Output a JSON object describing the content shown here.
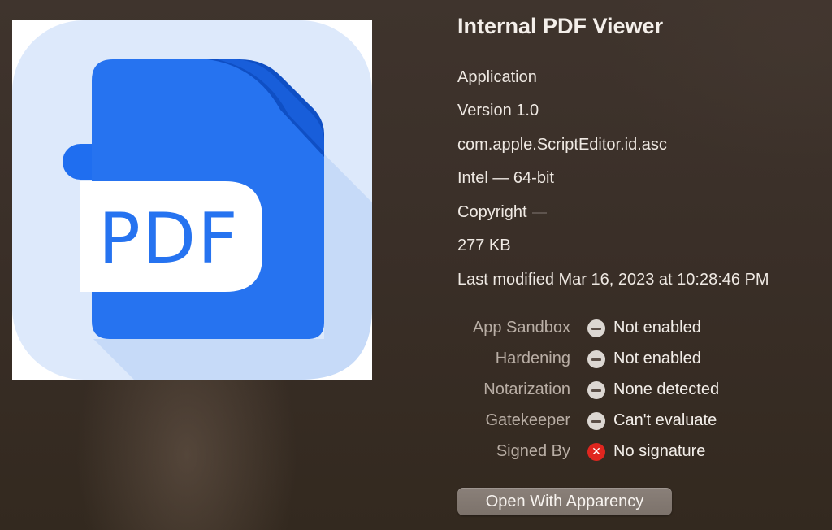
{
  "app": {
    "name": "Internal PDF Viewer",
    "icon": "pdf-document-icon",
    "icon_text": "PDF"
  },
  "info": {
    "kind": "Application",
    "version": "Version 1.0",
    "bundle_id": "com.apple.ScriptEditor.id.asc",
    "architecture": "Intel — 64-bit",
    "copyright_label": "Copyright",
    "size": "277 KB",
    "last_modified": "Last modified Mar 16, 2023 at 10:28:46 PM"
  },
  "security": [
    {
      "label": "App Sandbox",
      "status": "neutral",
      "icon": "minus-circle-icon",
      "value": "Not enabled"
    },
    {
      "label": "Hardening",
      "status": "neutral",
      "icon": "minus-circle-icon",
      "value": "Not enabled"
    },
    {
      "label": "Notarization",
      "status": "neutral",
      "icon": "minus-circle-icon",
      "value": "None detected"
    },
    {
      "label": "Gatekeeper",
      "status": "neutral",
      "icon": "minus-circle-icon",
      "value": "Can't evaluate"
    },
    {
      "label": "Signed By",
      "status": "error",
      "icon": "x-circle-icon",
      "value": "No signature"
    }
  ],
  "actions": {
    "open_with": "Open With Apparency"
  },
  "colors": {
    "icon_background": "#dde9fb",
    "document_blue": "#2673f0",
    "document_fold": "#0f4fc4",
    "error_red": "#e0261f"
  }
}
